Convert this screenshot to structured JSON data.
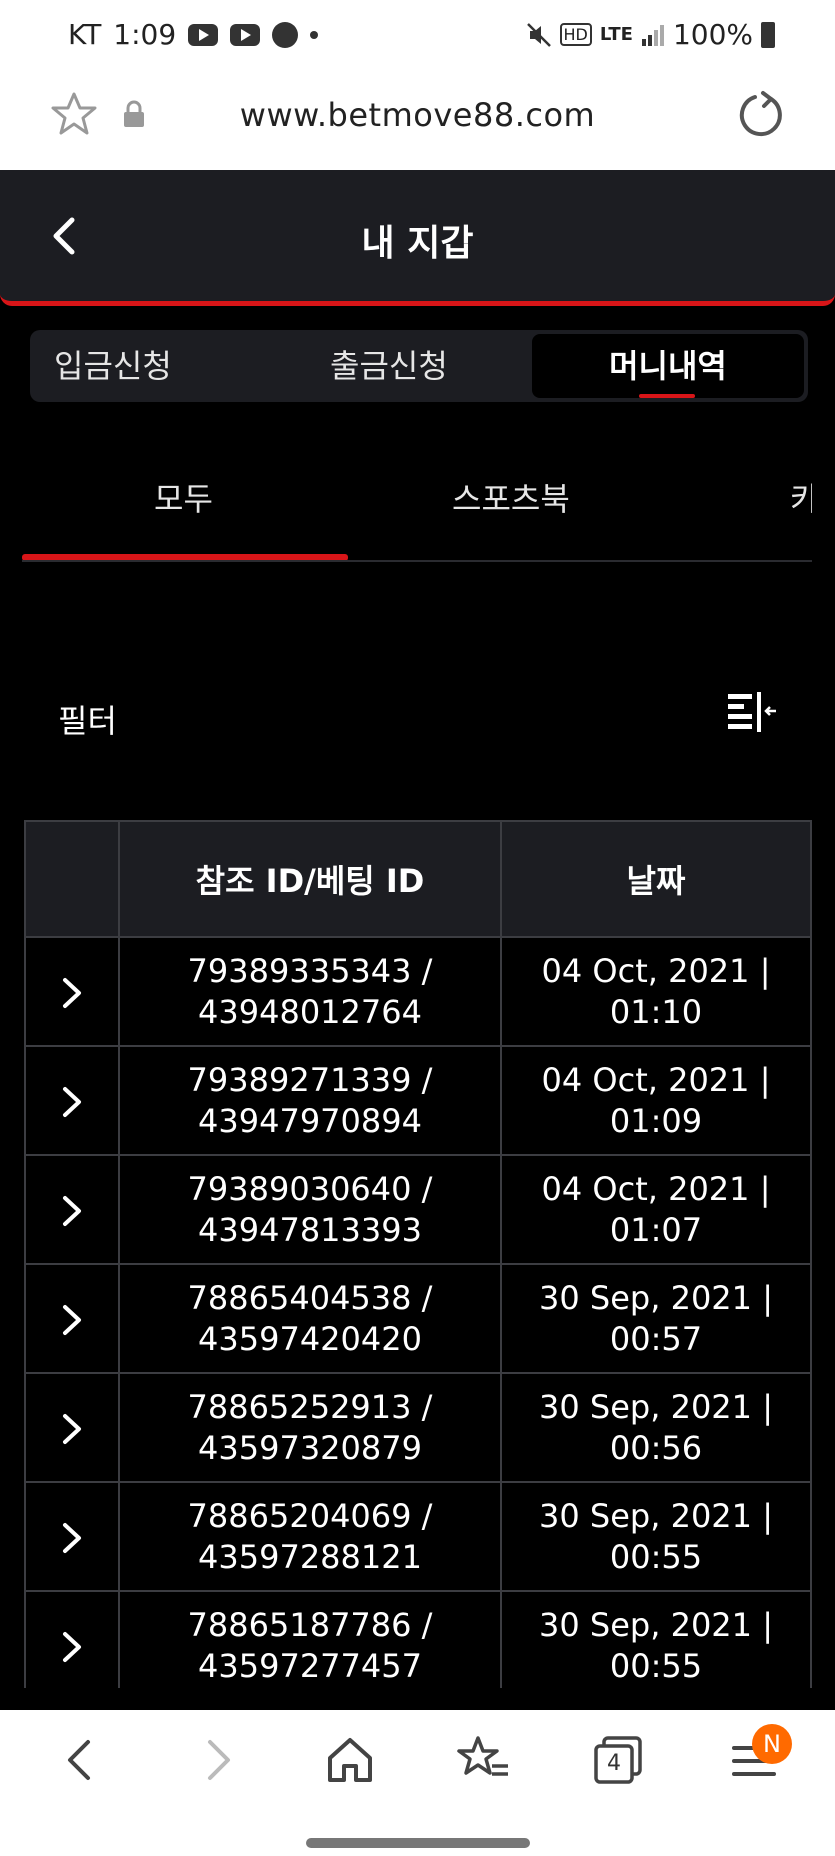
{
  "status_bar": {
    "carrier": "KT",
    "time": "1:09",
    "network": "LTE",
    "hd": "HD",
    "battery": "100%"
  },
  "browser": {
    "url": "www.betmove88.com",
    "tabs_count": "4",
    "menu_badge": "N"
  },
  "page": {
    "title": "내 지갑"
  },
  "wallet_tabs": [
    {
      "label": "입금신청"
    },
    {
      "label": "출금신청"
    },
    {
      "label": "머니내역"
    }
  ],
  "category_tabs": [
    {
      "label": "모두"
    },
    {
      "label": "스포츠북"
    },
    {
      "label": "카"
    }
  ],
  "filter": {
    "label": "필터"
  },
  "table": {
    "headers": [
      "",
      "참조 ID/베팅 ID",
      "날짜"
    ],
    "rows": [
      {
        "ref": "79389335343 /",
        "bet": "43948012764",
        "date": "04 Oct, 2021 |",
        "time": "01:10"
      },
      {
        "ref": "79389271339 /",
        "bet": "43947970894",
        "date": "04 Oct, 2021 |",
        "time": "01:09"
      },
      {
        "ref": "79389030640 /",
        "bet": "43947813393",
        "date": "04 Oct, 2021 |",
        "time": "01:07"
      },
      {
        "ref": "78865404538 /",
        "bet": "43597420420",
        "date": "30 Sep, 2021 |",
        "time": "00:57"
      },
      {
        "ref": "78865252913 /",
        "bet": "43597320879",
        "date": "30 Sep, 2021 |",
        "time": "00:56"
      },
      {
        "ref": "78865204069 /",
        "bet": "43597288121",
        "date": "30 Sep, 2021 |",
        "time": "00:55"
      },
      {
        "ref": "78865187786 /",
        "bet": "43597277457",
        "date": "30 Sep, 2021 |",
        "time": "00:55"
      }
    ]
  },
  "colors": {
    "accent": "#d81518",
    "panel": "#1c1d22",
    "background": "#000000",
    "badge": "#ff6a00"
  }
}
